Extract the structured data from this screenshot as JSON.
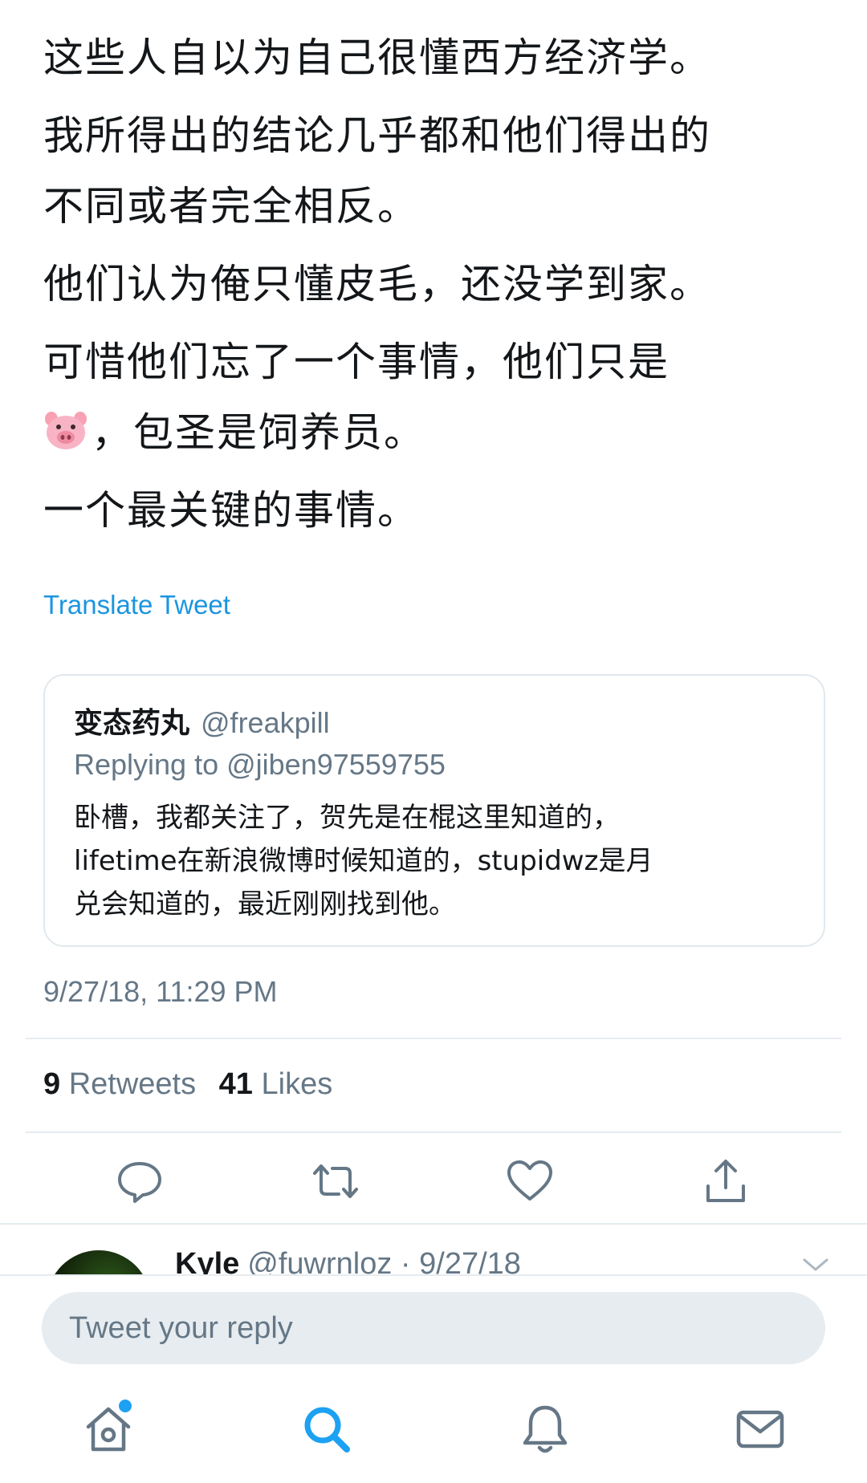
{
  "tweet": {
    "paragraphs": [
      "这些人自以为自己很懂西方经济学。",
      "我所得出的结论几乎都和他们得出的",
      "不同或者完全相反。",
      "他们认为俺只懂皮毛，还没学到家。",
      "可惜他们忘了一个事情，他们只是",
      "，包圣是饲养员。",
      "一个最关键的事情。"
    ],
    "emoji": "pig-face-emoji",
    "translate_label": "Translate Tweet",
    "timestamp": "9/27/18, 11:29 PM"
  },
  "quote": {
    "name": "变态药丸",
    "handle": "@freakpill",
    "replying_to": "Replying to @jiben97559755",
    "lines": [
      "卧槽，我都关注了，贺先是在棍这里知道的，",
      "lifetime在新浪微博时候知道的，stupidwz是月",
      "兑会知道的，最近刚刚找到他。"
    ]
  },
  "stats": {
    "retweets_count": "9",
    "retweets_label": "Retweets",
    "likes_count": "41",
    "likes_label": "Likes"
  },
  "actions": {
    "reply_icon": "reply-icon",
    "retweet_icon": "retweet-icon",
    "like_icon": "heart-icon",
    "share_icon": "share-icon"
  },
  "reply_preview": {
    "name": "Kyle",
    "meta": "@fuwrnloz · 9/27/18"
  },
  "compose": {
    "placeholder": "Tweet your reply"
  },
  "tab_bar": {
    "items": [
      "home-icon",
      "search-icon",
      "notifications-icon",
      "messages-icon"
    ],
    "accent": "#1da1f2"
  },
  "colors": {
    "text": "#14171a",
    "secondary": "#657786",
    "link": "#1b95e0",
    "divider": "#e6ecf0"
  }
}
